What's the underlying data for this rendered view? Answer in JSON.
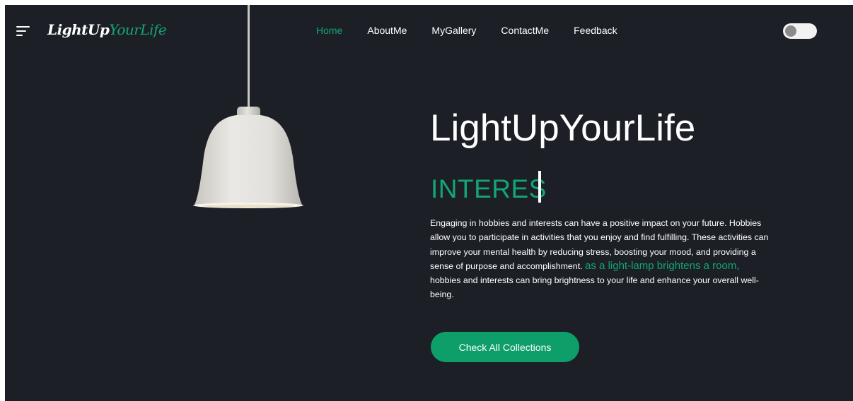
{
  "header": {
    "logo_part1": "LightUp",
    "logo_part2": "YourLife",
    "nav": [
      {
        "label": "Home",
        "active": true
      },
      {
        "label": "AboutMe",
        "active": false
      },
      {
        "label": "MyGallery",
        "active": false
      },
      {
        "label": "ContactMe",
        "active": false
      },
      {
        "label": "Feedback",
        "active": false
      }
    ],
    "theme_toggle_on": false
  },
  "hero": {
    "title": "LightUpYourLife",
    "typed_text": "INTERES",
    "description_before": "Engaging in hobbies and interests can have a positive impact on your future. Hobbies allow you to participate in activities that you enjoy and find fulfilling. These activities can improve your mental health by reducing stress, boosting your mood, and providing a sense of purpose and accomplishment.",
    "description_highlight": "as a light-lamp brightens a room,",
    "description_after": "hobbies and interests can bring brightness to your life and enhance your overall well-being.",
    "cta_label": "Check All Collections"
  },
  "colors": {
    "background": "#1c1f26",
    "accent": "#13a576",
    "button": "#0e9e6a",
    "text": "#ffffff"
  },
  "icons": {
    "menu": "hamburger-menu-icon",
    "lamp": "pendant-lamp-image"
  }
}
